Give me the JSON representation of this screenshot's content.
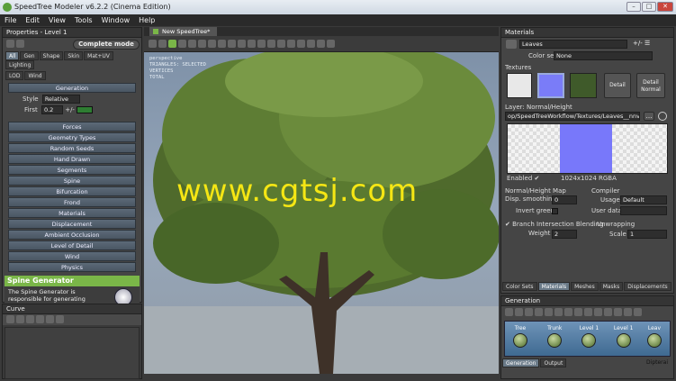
{
  "window": {
    "title": "SpeedTree Modeler v6.2.2 (Cinema Edition)",
    "min": "–",
    "max": "□",
    "close": "✕"
  },
  "menu": [
    "File",
    "Edit",
    "View",
    "Tools",
    "Window",
    "Help"
  ],
  "properties": {
    "title": "Properties - Level 1",
    "mode": "Complete mode",
    "tabs": [
      "All",
      "Gen",
      "Shape",
      "Skin",
      "Mat+UV",
      "Lighting",
      "LOD",
      "Wind"
    ],
    "generation_header": "Generation",
    "style_label": "Style",
    "style_value": "Relative",
    "first_label": "First",
    "first_value": "0.2",
    "first_extra": "+/-",
    "categories": [
      "Forces",
      "Geometry Types",
      "Random Seeds",
      "Hand Drawn",
      "Segments",
      "Spine",
      "Bifurcation",
      "Frond",
      "Materials",
      "Displacement",
      "Ambient Occlusion",
      "Level of Detail",
      "Wind",
      "Physics"
    ],
    "help_title": "Spine Generator",
    "help_text": "The Spine Generator is responsible for generating"
  },
  "curve": {
    "title": "Curve"
  },
  "viewport": {
    "tab": "New SpeedTree*",
    "overlay": [
      "perspective",
      "TRIANGLES: SELECTED",
      "VERTICES",
      "TOTAL"
    ],
    "watermark": "www.cgtsj.com"
  },
  "materials": {
    "title": "Materials",
    "name": "Leaves",
    "colorset_label": "Color set",
    "colorset_value": "None",
    "textures_label": "Textures",
    "detail_label": "Detail",
    "detail_normal_label": "Detail Normal",
    "layer_label": "Layer: Normal/Height",
    "path": "op/SpeedTreeWorkflow/Textures/Leaves__nnv.tif",
    "enabled_label": "Enabled",
    "resolution": "1024x1024 RGBA",
    "normal_map_label": "Normal/Height Map",
    "disp_smoothing_label": "Disp. smoothing",
    "disp_smoothing_value": "0",
    "invert_green_label": "Invert green",
    "compiler_label": "Compiler",
    "usage_label": "Usage",
    "usage_value": "Default",
    "user_data_label": "User data",
    "blend_label": "Branch Intersection Blending",
    "weight_label": "Weight",
    "weight_value": "2",
    "unwrap_label": "Unwrapping",
    "scale_label": "Scale",
    "scale_value": "1",
    "bottom_tabs": [
      "Color Sets",
      "Materials",
      "Meshes",
      "Masks",
      "Displacements"
    ]
  },
  "generation": {
    "title": "Generation",
    "nodes": [
      "Tree",
      "Trunk",
      "Level 1",
      "Level 1",
      "Leav"
    ],
    "bottom_tabs": [
      "Generation",
      "Output"
    ],
    "corner": "Dipterai"
  },
  "colors": {
    "accent": "#7ab648",
    "panel": "#454545",
    "selected_tab": "#6a7a88",
    "watermark": "#f5e614"
  }
}
